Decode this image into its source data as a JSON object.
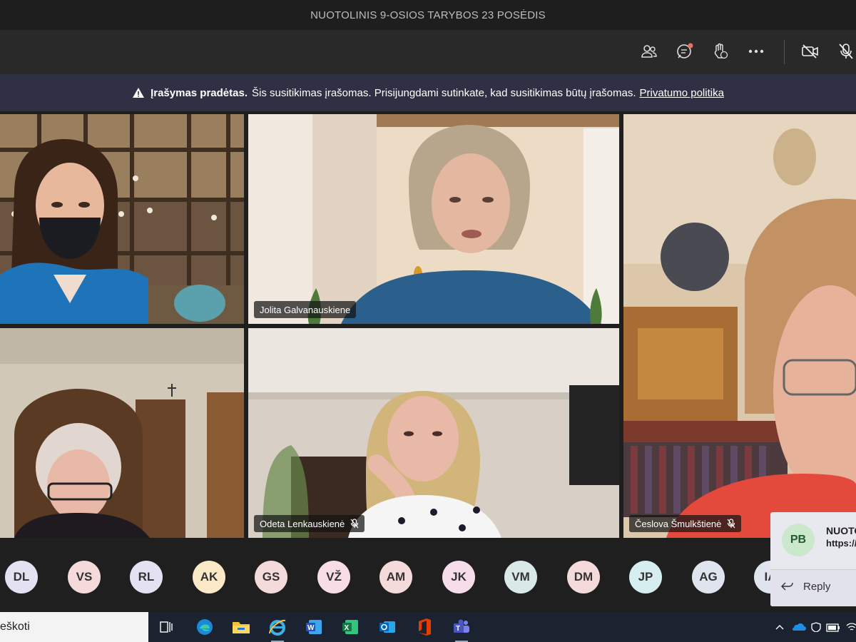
{
  "window": {
    "title": "NUOTOLINIS 9-OSIOS TARYBOS 23 POSĖDIS"
  },
  "toolbar": {
    "participants_icon": "people-icon",
    "chat_icon": "chat-icon",
    "reactions_icon": "raise-hand-icon",
    "more_icon": "more-icon",
    "camera_icon": "camera-off-icon",
    "mic_icon": "mic-off-icon"
  },
  "banner": {
    "bold": "Įrašymas pradėtas.",
    "text": "Šis susitikimas įrašomas. Prisijungdami sutinkate, kad susitikimas būtų įrašomas.",
    "link": "Privatumo politika"
  },
  "tiles": [
    {
      "name": ""
    },
    {
      "name": "Jolita Galvanauskiene"
    },
    {
      "name": ""
    },
    {
      "name": ""
    },
    {
      "name": "Odeta Lenkauskienė"
    },
    {
      "name": "Česlova Šmulkštienė"
    }
  ],
  "roster": [
    {
      "initials": "DL",
      "color": "#e3e1f2"
    },
    {
      "initials": "VS",
      "color": "#f5dadb"
    },
    {
      "initials": "RL",
      "color": "#e3e1f2"
    },
    {
      "initials": "AK",
      "color": "#fbe9c8"
    },
    {
      "initials": "GS",
      "color": "#f5dadb"
    },
    {
      "initials": "VŽ",
      "color": "#f9dde6"
    },
    {
      "initials": "AM",
      "color": "#f5dadb"
    },
    {
      "initials": "JK",
      "color": "#f7dde9"
    },
    {
      "initials": "VM",
      "color": "#d8e9e8"
    },
    {
      "initials": "DM",
      "color": "#f5dadb"
    },
    {
      "initials": "JP",
      "color": "#d7eef0"
    },
    {
      "initials": "AG",
      "color": "#dfe4ef"
    },
    {
      "initials": "IA",
      "color": "#dfe4ef"
    }
  ],
  "toast": {
    "initials": "PB",
    "title": "NUOTO",
    "url": "https://",
    "reply": "Reply"
  },
  "taskbar": {
    "search": "eškoti"
  }
}
